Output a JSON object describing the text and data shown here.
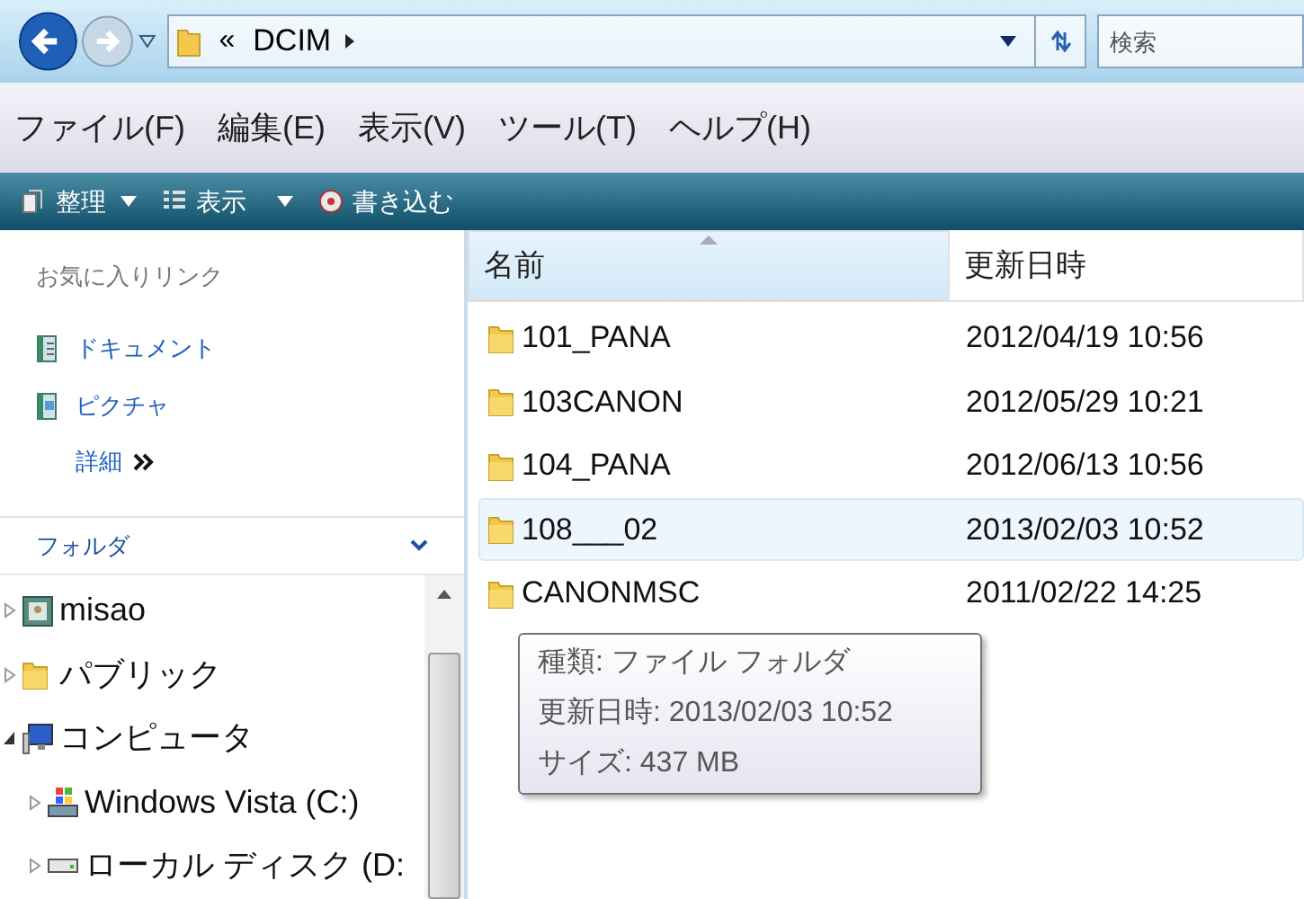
{
  "address_bar": {
    "prefix": "«",
    "path": "DCIM"
  },
  "search": {
    "placeholder": "検索"
  },
  "menu": [
    "ファイル(F)",
    "編集(E)",
    "表示(V)",
    "ツール(T)",
    "ヘルプ(H)"
  ],
  "toolbar": [
    {
      "label": "整理",
      "kind": "dropdown"
    },
    {
      "label": "表示",
      "kind": "dropdown"
    },
    {
      "label": "書き込む",
      "kind": "button"
    }
  ],
  "favorites": {
    "title": "お気に入りリンク",
    "items": [
      {
        "label": "ドキュメント"
      },
      {
        "label": "ピクチャ"
      }
    ],
    "more": "詳細"
  },
  "folders": {
    "title": "フォルダ",
    "tree": [
      {
        "label": "misao",
        "kind": "user",
        "expanded": false
      },
      {
        "label": "パブリック",
        "kind": "folder",
        "expanded": false
      },
      {
        "label": "コンピュータ",
        "kind": "computer",
        "expanded": true,
        "children": [
          {
            "label": "Windows Vista (C:)",
            "kind": "system-drive",
            "expanded": false
          },
          {
            "label": "ローカル ディスク (D:",
            "kind": "drive",
            "expanded": false
          }
        ]
      }
    ]
  },
  "file_list": {
    "columns": [
      {
        "label": "名前",
        "sorted": true
      },
      {
        "label": "更新日時",
        "sorted": false
      }
    ],
    "rows": [
      {
        "name": "101_PANA",
        "modified": "2012/04/19 10:56",
        "hovered": false
      },
      {
        "name": "103CANON",
        "modified": "2012/05/29 10:21",
        "hovered": false
      },
      {
        "name": "104_PANA",
        "modified": "2012/06/13 10:56",
        "hovered": false
      },
      {
        "name": "108___02",
        "modified": "2013/02/03 10:52",
        "hovered": true
      },
      {
        "name": "CANONMSC",
        "modified": "2011/02/22 14:25",
        "hovered": false
      }
    ]
  },
  "tooltip": {
    "lines": [
      "種類: ファイル フォルダ",
      "更新日時: 2013/02/03 10:52",
      "サイズ: 437 MB"
    ]
  }
}
